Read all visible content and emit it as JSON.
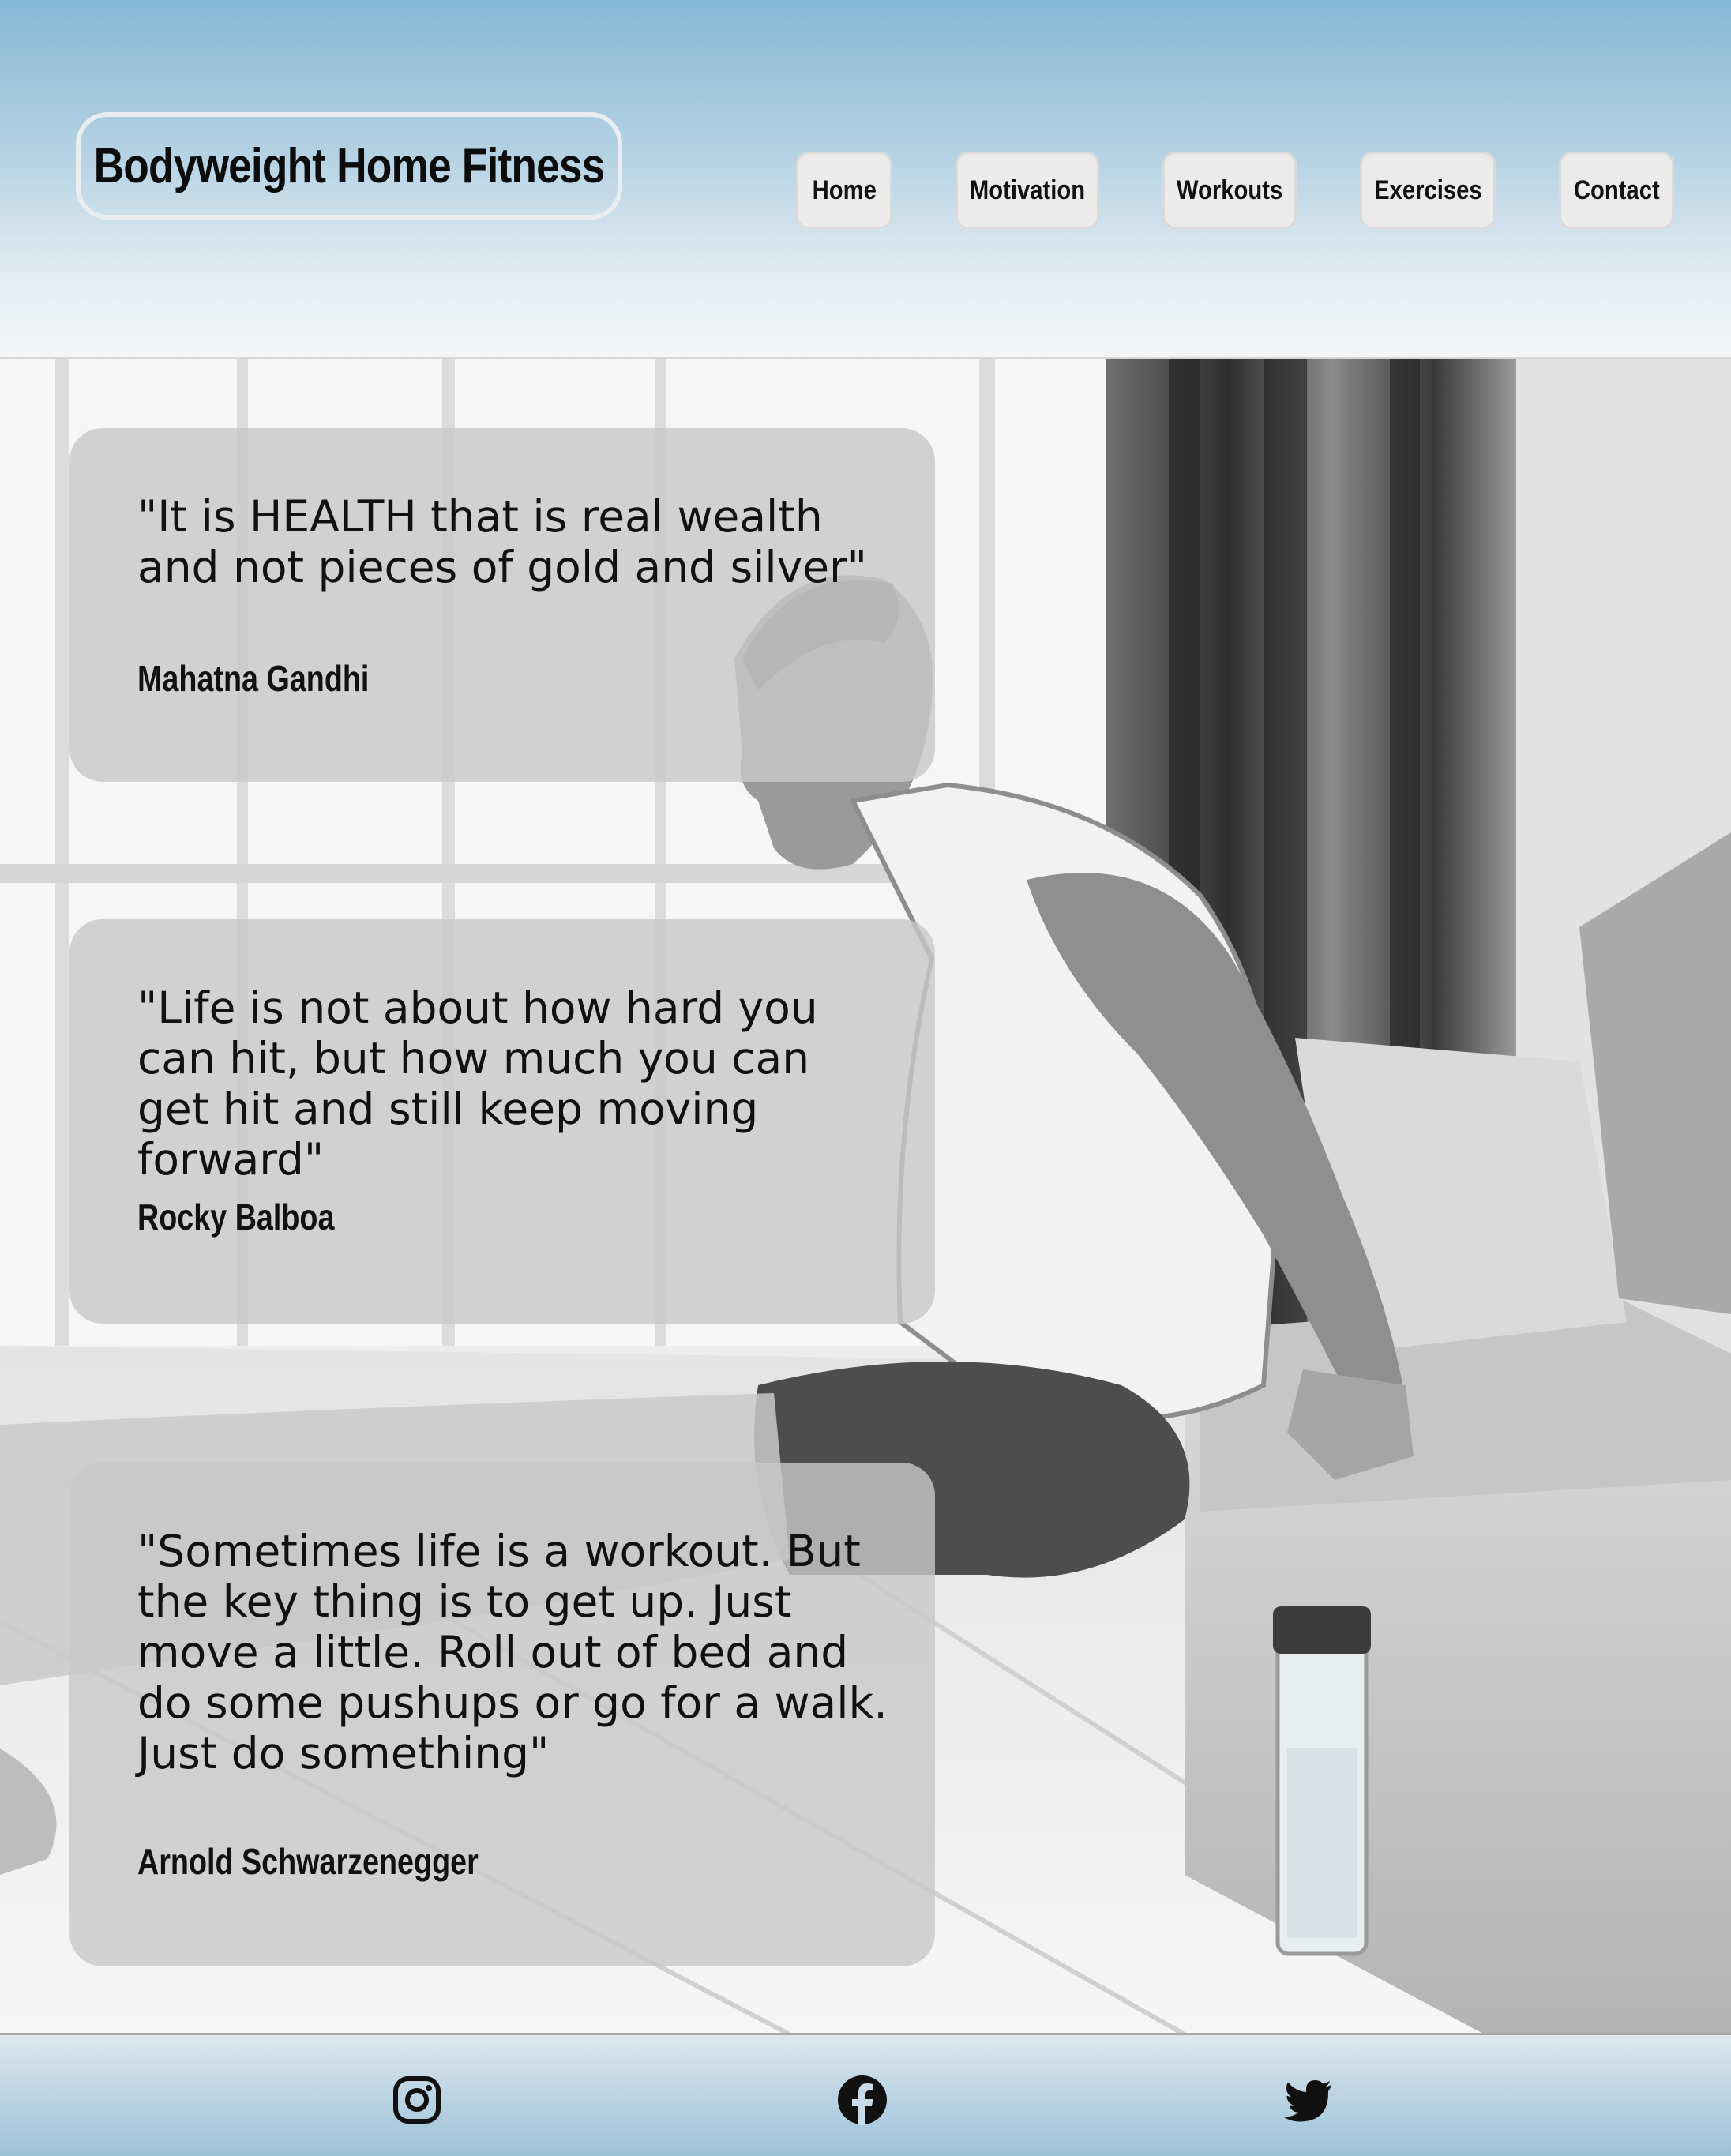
{
  "site": {
    "title": "Bodyweight Home Fitness"
  },
  "nav": {
    "items": [
      {
        "label": "Home"
      },
      {
        "label": "Motivation"
      },
      {
        "label": "Workouts"
      },
      {
        "label": "Exercises"
      },
      {
        "label": "Contact"
      }
    ]
  },
  "quotes": [
    {
      "text": "\"It is HEALTH that is real wealth and not pieces of gold and silver\"",
      "author": "Mahatna Gandhi"
    },
    {
      "text": "\"Life is not about how hard you can hit, but how much you can get hit and still keep moving forward\"",
      "author": "Rocky Balboa"
    },
    {
      "text": "\"Sometimes life is a workout. But the key thing is to get up. Just move a little. Roll out of bed and do some pushups or go for a walk. Just do something\"",
      "author": "Arnold Schwarzenegger"
    }
  ],
  "social": {
    "icons": [
      "instagram-icon",
      "facebook-icon",
      "twitter-icon"
    ]
  },
  "colors": {
    "header_top": "#85b8d4",
    "footer_bottom": "#9ec2d8",
    "button_bg": "#ebebeb",
    "text": "#111111"
  }
}
